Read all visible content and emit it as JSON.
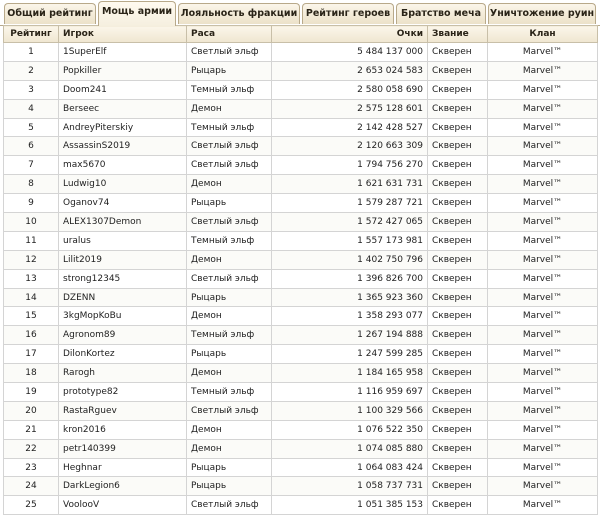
{
  "tabs": [
    {
      "label": "Общий рейтинг",
      "active": false
    },
    {
      "label": "Мощь армии",
      "active": true
    },
    {
      "label": "Лояльность фракции",
      "active": false
    },
    {
      "label": "Рейтинг героев",
      "active": false
    },
    {
      "label": "Братство меча",
      "active": false
    },
    {
      "label": "Уничтожение руин",
      "active": false
    }
  ],
  "table": {
    "columns": {
      "rank": "Рейтинг",
      "player": "Игрок",
      "race": "Раса",
      "score": "Очки",
      "title": "Звание",
      "clan": "Клан"
    },
    "rows": [
      {
        "rank": "1",
        "player": "1SuperElf",
        "race": "Светлый эльф",
        "score": "5 484 137 000",
        "title": "Скверен",
        "clan": "Marvel™"
      },
      {
        "rank": "2",
        "player": "Popkiller",
        "race": "Рыцарь",
        "score": "2 653 024 583",
        "title": "Скверен",
        "clan": "Marvel™"
      },
      {
        "rank": "3",
        "player": "Doom241",
        "race": "Темный эльф",
        "score": "2 580 058 690",
        "title": "Скверен",
        "clan": "Marvel™"
      },
      {
        "rank": "4",
        "player": "Berseec",
        "race": "Демон",
        "score": "2 575 128 601",
        "title": "Скверен",
        "clan": "Marvel™"
      },
      {
        "rank": "5",
        "player": "AndreyPiterskiy",
        "race": "Темный эльф",
        "score": "2 142 428 527",
        "title": "Скверен",
        "clan": "Marvel™"
      },
      {
        "rank": "6",
        "player": "AssassinS2019",
        "race": "Светлый эльф",
        "score": "2 120 663 309",
        "title": "Скверен",
        "clan": "Marvel™"
      },
      {
        "rank": "7",
        "player": "max5670",
        "race": "Светлый эльф",
        "score": "1 794 756 270",
        "title": "Скверен",
        "clan": "Marvel™"
      },
      {
        "rank": "8",
        "player": "Ludwig10",
        "race": "Демон",
        "score": "1 621 631 731",
        "title": "Скверен",
        "clan": "Marvel™"
      },
      {
        "rank": "9",
        "player": "Oganov74",
        "race": "Рыцарь",
        "score": "1 579 287 721",
        "title": "Скверен",
        "clan": "Marvel™"
      },
      {
        "rank": "10",
        "player": "ALEX1307Demon",
        "race": "Светлый эльф",
        "score": "1 572 427 065",
        "title": "Скверен",
        "clan": "Marvel™"
      },
      {
        "rank": "11",
        "player": "uralus",
        "race": "Темный эльф",
        "score": "1 557 173 981",
        "title": "Скверен",
        "clan": "Marvel™"
      },
      {
        "rank": "12",
        "player": "Lilit2019",
        "race": "Демон",
        "score": "1 402 750 796",
        "title": "Скверен",
        "clan": "Marvel™"
      },
      {
        "rank": "13",
        "player": "strong12345",
        "race": "Светлый эльф",
        "score": "1 396 826 700",
        "title": "Скверен",
        "clan": "Marvel™"
      },
      {
        "rank": "14",
        "player": "DZENN",
        "race": "Рыцарь",
        "score": "1 365 923 360",
        "title": "Скверен",
        "clan": "Marvel™"
      },
      {
        "rank": "15",
        "player": "3kgMopKoBu",
        "race": "Демон",
        "score": "1 358 293 077",
        "title": "Скверен",
        "clan": "Marvel™"
      },
      {
        "rank": "16",
        "player": "Agronom89",
        "race": "Темный эльф",
        "score": "1 267 194 888",
        "title": "Скверен",
        "clan": "Marvel™"
      },
      {
        "rank": "17",
        "player": "DilonKortez",
        "race": "Рыцарь",
        "score": "1 247 599 285",
        "title": "Скверен",
        "clan": "Marvel™"
      },
      {
        "rank": "18",
        "player": "Rarogh",
        "race": "Демон",
        "score": "1 184 165 958",
        "title": "Скверен",
        "clan": "Marvel™"
      },
      {
        "rank": "19",
        "player": "prototype82",
        "race": "Темный эльф",
        "score": "1 116 959 697",
        "title": "Скверен",
        "clan": "Marvel™"
      },
      {
        "rank": "20",
        "player": "RastaRguev",
        "race": "Светлый эльф",
        "score": "1 100 329 566",
        "title": "Скверен",
        "clan": "Marvel™"
      },
      {
        "rank": "21",
        "player": "kron2016",
        "race": "Демон",
        "score": "1 076 522 350",
        "title": "Скверен",
        "clan": "Marvel™"
      },
      {
        "rank": "22",
        "player": "petr140399",
        "race": "Демон",
        "score": "1 074 085 880",
        "title": "Скверен",
        "clan": "Marvel™"
      },
      {
        "rank": "23",
        "player": "Heghnar",
        "race": "Рыцарь",
        "score": "1 064 083 424",
        "title": "Скверен",
        "clan": "Marvel™"
      },
      {
        "rank": "24",
        "player": "DarkLegion6",
        "race": "Рыцарь",
        "score": "1 058 737 731",
        "title": "Скверен",
        "clan": "Marvel™"
      },
      {
        "rank": "25",
        "player": "VoolooV",
        "race": "Светлый эльф",
        "score": "1 051 385 153",
        "title": "Скверен",
        "clan": "Marvel™"
      }
    ]
  }
}
